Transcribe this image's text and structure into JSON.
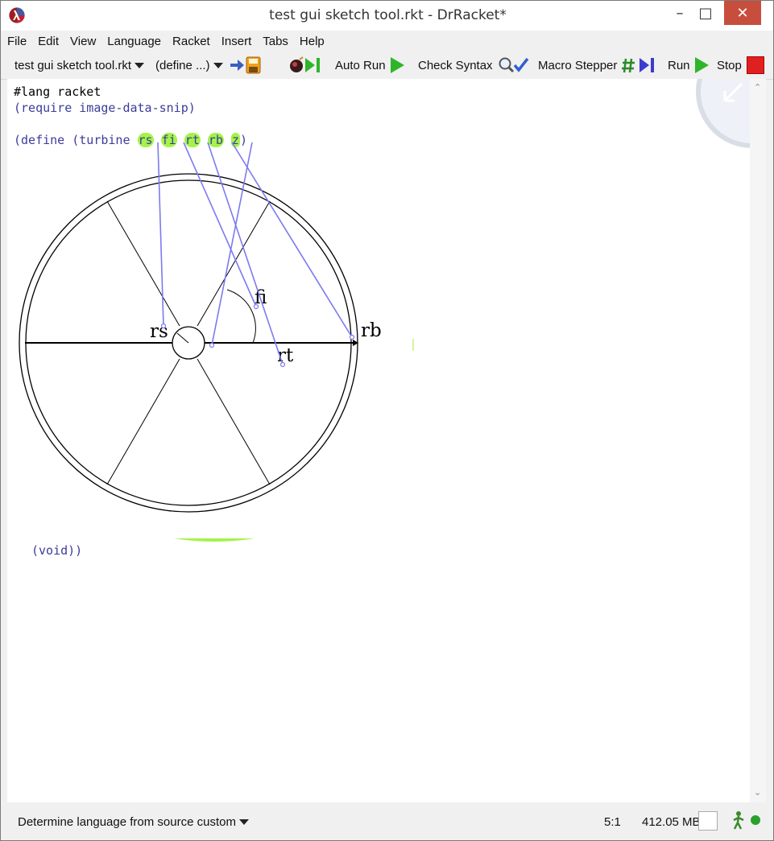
{
  "window": {
    "title": "test gui sketch tool.rkt - DrRacket*",
    "controls": {
      "minimize": "–",
      "maximize": "□",
      "close": "✕"
    }
  },
  "menu": [
    "File",
    "Edit",
    "View",
    "Language",
    "Racket",
    "Insert",
    "Tabs",
    "Help"
  ],
  "toolbar": {
    "file_selector": "test gui sketch tool.rkt",
    "define_selector": "(define ...)",
    "auto_run": "Auto Run",
    "check_syntax": "Check Syntax",
    "macro_stepper": "Macro Stepper",
    "run": "Run",
    "stop": "Stop"
  },
  "code": {
    "line1": "#lang racket",
    "line2": "(require image-data-snip)",
    "define_open": "(define (turbine ",
    "params": [
      "rs",
      "fi",
      "rt",
      "rb",
      "z"
    ],
    "define_close": ")",
    "void_line": "(void))"
  },
  "diagram": {
    "labels": {
      "rs": "rs",
      "fi": "fi",
      "rt": "rt",
      "rb": "rb"
    }
  },
  "status": {
    "language": "Determine language from source custom",
    "position": "5:1",
    "memory": "412.05 MB"
  },
  "colors": {
    "highlight": "#a4f349",
    "link_line": "#7b7bf0",
    "close_button": "#c74e3c",
    "run_green": "#2fb52a",
    "stop_red": "#e02020"
  },
  "icons": {
    "app": "racket-lambda-icon",
    "save": "save-icon",
    "debug": "bomb-step-icon",
    "check_syntax": "magnifier-check-icon",
    "macro": "hash-step-icon",
    "status": "walking-man-icon"
  }
}
